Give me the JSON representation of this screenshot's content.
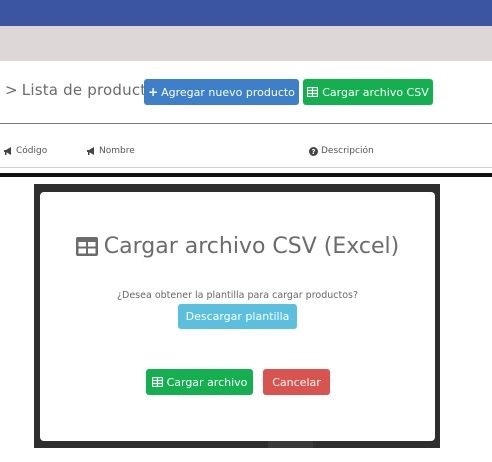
{
  "header": {
    "breadcrumb_chevron": ">",
    "title": "Lista de productos",
    "add_button_icon": "+",
    "add_button_label": "Agregar nuevo producto",
    "csv_button_label": "Cargar archivo CSV"
  },
  "table": {
    "columns": [
      {
        "label": "Código",
        "icon": "bullhorn-icon"
      },
      {
        "label": "Nombre",
        "icon": "bullhorn-icon"
      },
      {
        "label": "Descripción",
        "icon": "question-circle-icon"
      }
    ]
  },
  "modal": {
    "title": "Cargar archivo CSV (Excel)",
    "question": "¿Desea obtener la plantilla para cargar productos?",
    "download_button_label": "Descargar plantilla",
    "upload_button_label": "Cargar archivo",
    "cancel_button_label": "Cancelar"
  },
  "colors": {
    "topbar": "#3b55a3",
    "primary": "#3d7fc8",
    "success": "#14b04f",
    "info": "#5bc0de",
    "danger": "#d9534f"
  }
}
